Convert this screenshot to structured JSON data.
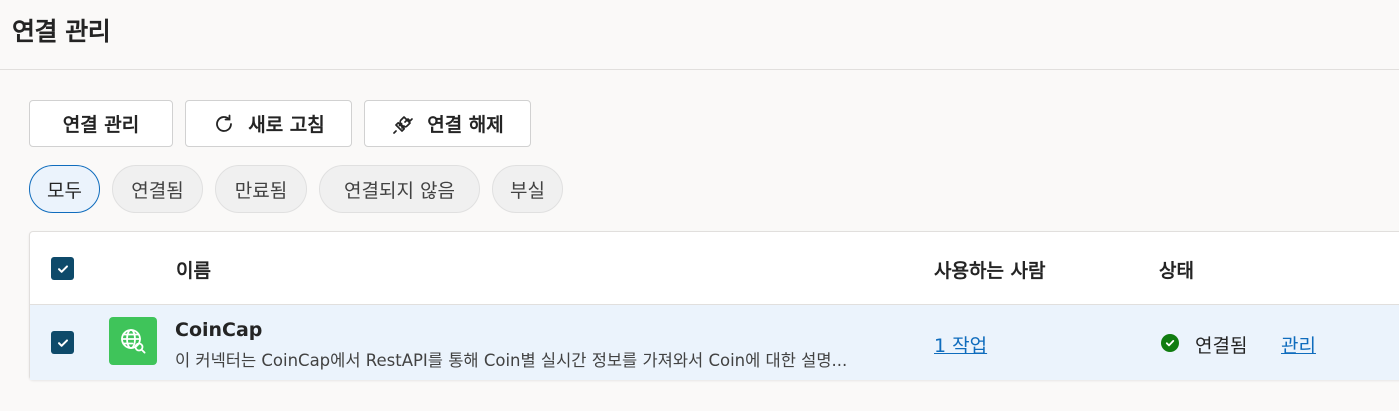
{
  "header": {
    "title": "연결 관리"
  },
  "toolbar": {
    "manage_label": "연결 관리",
    "refresh_label": "새로 고침",
    "disconnect_label": "연결 해제"
  },
  "filters": [
    "모두",
    "연결됨",
    "만료됨",
    "연결되지 않음",
    "부실"
  ],
  "filters_active": "모두",
  "table": {
    "columns": {
      "name": "이름",
      "used_by": "사용하는 사람",
      "status": "상태"
    },
    "rows": [
      {
        "name": "CoinCap",
        "description": "이 커넥터는 CoinCap에서 RestAPI를 통해 Coin별 실시간 정보를 가져와서 Coin에 대한 설명...",
        "used_by": "1 작업",
        "status": "연결됨",
        "action": "관리",
        "icon": "globe-search-icon",
        "selected": true
      }
    ]
  },
  "colors": {
    "accent": "#0f6cbd",
    "checkbox": "#0e4a6a",
    "app_icon_bg": "#3fc45a",
    "status_ok": "#107c10",
    "row_selected_bg": "#ebf3fc"
  }
}
